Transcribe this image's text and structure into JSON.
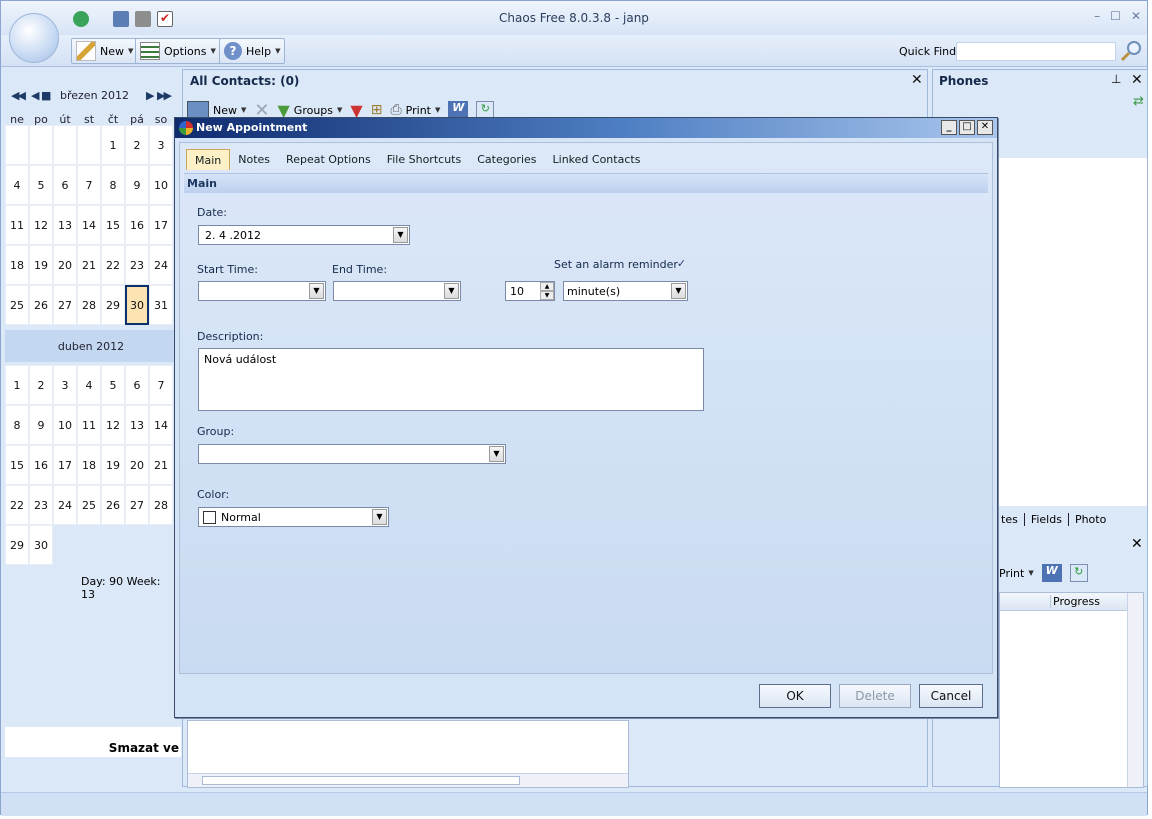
{
  "app": {
    "title": "Chaos Free 8.0.3.8 -   janp",
    "ribbon": {
      "new_label": "New",
      "options_label": "Options",
      "help_label": "Help"
    },
    "quick_find": {
      "label": "Quick Find",
      "value": ""
    }
  },
  "calendar": {
    "month1": "březen 2012",
    "month2": "duben 2012",
    "weekdays": [
      "ne",
      "po",
      "út",
      "st",
      "čt",
      "pá",
      "so"
    ],
    "march_days": [
      "",
      "",
      "",
      "",
      "1",
      "2",
      "3",
      "4",
      "5",
      "6",
      "7",
      "8",
      "9",
      "10",
      "11",
      "12",
      "13",
      "14",
      "15",
      "16",
      "17",
      "18",
      "19",
      "20",
      "21",
      "22",
      "23",
      "24",
      "25",
      "26",
      "27",
      "28",
      "29",
      "30",
      "31"
    ],
    "april_days": [
      "1",
      "2",
      "3",
      "4",
      "5",
      "6",
      "7",
      "8",
      "9",
      "10",
      "11",
      "12",
      "13",
      "14",
      "15",
      "16",
      "17",
      "18",
      "19",
      "20",
      "21",
      "22",
      "23",
      "24",
      "25",
      "26",
      "27",
      "28",
      "29",
      "30"
    ],
    "today": "30",
    "day_week": "Day: 90  Week: 13",
    "bottom_text": "Smazat ve"
  },
  "contacts": {
    "title": "All Contacts:  (0)",
    "toolbar": {
      "new": "New",
      "groups": "Groups",
      "print": "Print"
    }
  },
  "phones": {
    "title": "Phones",
    "tabs": [
      "tes",
      "Fields",
      "Photo"
    ],
    "print": "Print",
    "column": "Progress"
  },
  "dialog": {
    "title": "New Appointment",
    "tabs": [
      "Main",
      "Notes",
      "Repeat Options",
      "File Shortcuts",
      "Categories",
      "Linked Contacts"
    ],
    "section": "Main",
    "date_label": "Date:",
    "date_value": "2. 4 .2012",
    "start_label": "Start Time:",
    "start_value": "",
    "end_label": "End Time:",
    "end_value": "",
    "alarm_label": "Set an alarm reminder",
    "alarm_checked": true,
    "alarm_amount": "10",
    "alarm_unit": "minute(s)",
    "description_label": "Description:",
    "description_value": "Nová událost",
    "group_label": "Group:",
    "group_value": "",
    "color_label": "Color:",
    "color_value": "Normal",
    "ok": "OK",
    "delete": "Delete",
    "cancel": "Cancel"
  }
}
